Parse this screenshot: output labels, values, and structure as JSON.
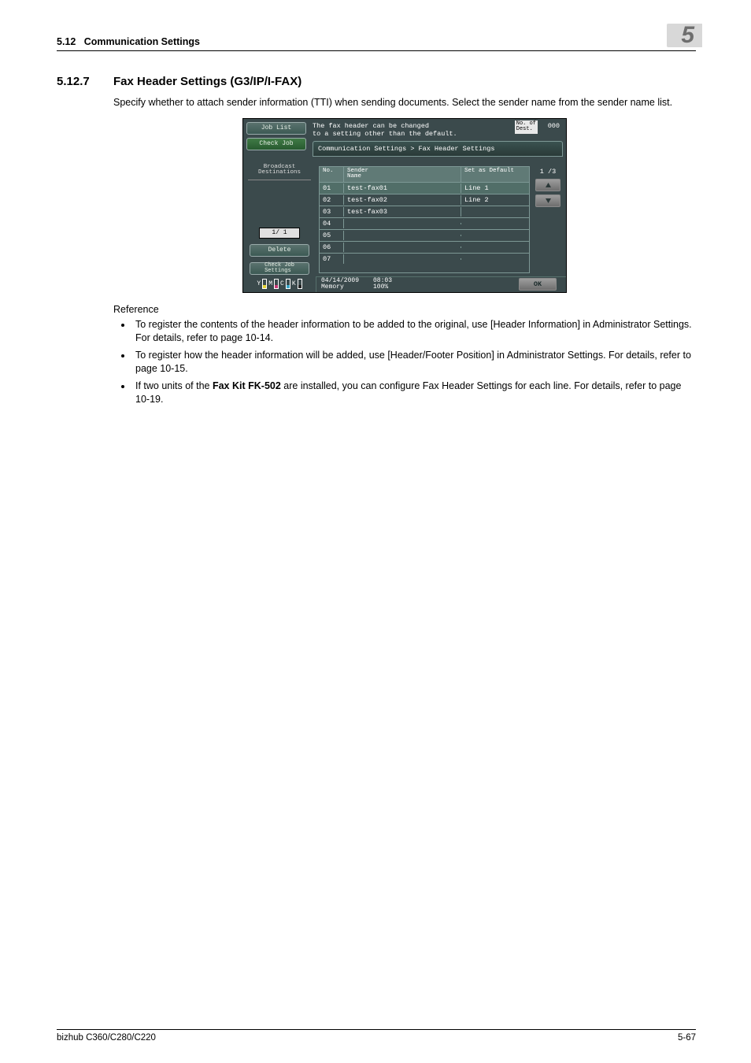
{
  "header": {
    "section": "5.12",
    "title": "Communication Settings",
    "chapter": "5"
  },
  "section": {
    "number": "5.12.7",
    "title": "Fax Header Settings (G3/IP/I-FAX)"
  },
  "intro": "Specify whether to attach sender information (TTI) when sending documents. Select the sender name from the sender name list.",
  "screen": {
    "jobList": "Job List",
    "checkJob": "Check Job",
    "msg1": "The fax header can be changed",
    "msg2": "to a setting other than the default.",
    "destLabel": "No. of\nDest.",
    "destCount": "000",
    "breadcrumb": "Communication Settings > Fax Header Settings",
    "broadcast": "Broadcast\nDestinations",
    "leftPage": "1/  1",
    "delete": "Delete",
    "checkJobSettings": "Check Job\nSettings",
    "cols": {
      "no": "No.",
      "sender": "Sender\nName",
      "default": "Set as Default"
    },
    "rows": [
      {
        "no": "01",
        "sender": "test-fax01",
        "dft": "Line 1",
        "sel": true
      },
      {
        "no": "02",
        "sender": "test-fax02",
        "dft": "Line 2",
        "sel": false
      },
      {
        "no": "03",
        "sender": "test-fax03",
        "dft": "",
        "sel": false
      },
      {
        "no": "04",
        "sender": "",
        "dft": "",
        "sel": false
      },
      {
        "no": "05",
        "sender": "",
        "dft": "",
        "sel": false
      },
      {
        "no": "06",
        "sender": "",
        "dft": "",
        "sel": false
      },
      {
        "no": "07",
        "sender": "",
        "dft": "",
        "sel": false
      }
    ],
    "pager": "1 /3",
    "status": {
      "date": "04/14/2009",
      "time": "08:03",
      "memLabel": "Memory",
      "memVal": "100%",
      "ok": "OK"
    }
  },
  "reference": {
    "heading": "Reference",
    "items": [
      "To register the contents of the header information to be added to the original, use [Header Information] in Administrator Settings. For details, refer to page 10-14.",
      "To register how the header information will be added, use [Header/Footer Position] in Administrator Settings. For details, refer to page 10-15.",
      "If two units of the <b>Fax Kit FK-502</b> are installed, you can configure Fax Header Settings for each line. For details, refer to page 10-19."
    ]
  },
  "footer": {
    "left": "bizhub C360/C280/C220",
    "right": "5-67"
  }
}
